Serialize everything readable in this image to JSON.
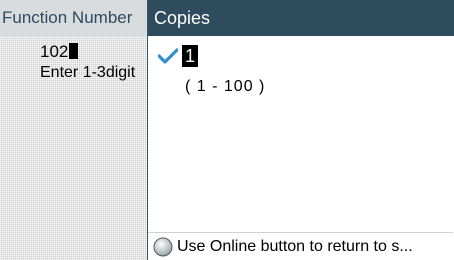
{
  "background": {
    "title": "Function Number",
    "value": "102",
    "hint": "Enter 1-3digit"
  },
  "dialog": {
    "title": "Copies",
    "value": "1",
    "range": "( 1 - 100 )",
    "check_icon": "checkmark-icon",
    "footer_icon": "online-button-icon",
    "footer_text": "Use Online button to return to s..."
  },
  "colors": {
    "header_dark": "#2f4b5e",
    "header_light": "#d9dcde",
    "check": "#2f8fd1"
  }
}
